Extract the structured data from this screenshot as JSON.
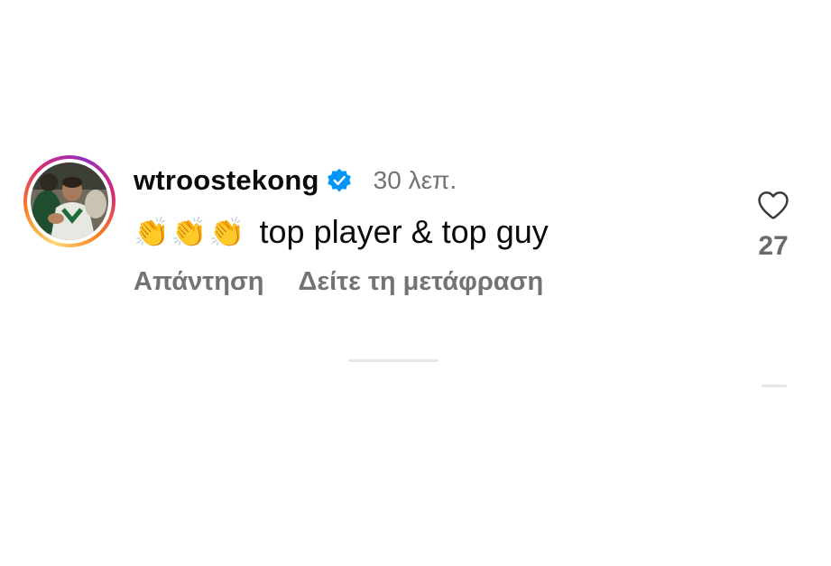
{
  "comment": {
    "username": "wtroostekong",
    "verified_icon": "verified-badge-icon",
    "timestamp": "30 λεπ.",
    "emoji": "👏👏👏",
    "text": "top player & top guy",
    "reply_label": "Απάντηση",
    "translate_label": "Δείτε τη μετάφραση",
    "like_icon": "heart-outline-icon",
    "like_count": "27"
  },
  "colors": {
    "verified_blue": "#0095f6",
    "secondary_text": "#737373",
    "primary_text": "#0b0b0b",
    "story_ring": [
      "#feda75",
      "#fa7e1e",
      "#d62976",
      "#962fbf"
    ]
  }
}
